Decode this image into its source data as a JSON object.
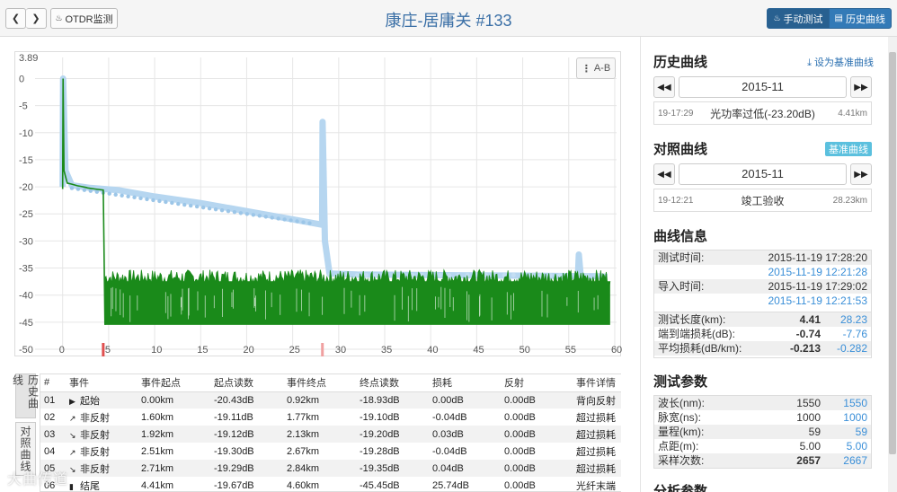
{
  "header": {
    "prev_icon": "chevron-left",
    "next_icon": "chevron-right",
    "otdr_label": "OTDR监测",
    "title": "康庄-居庸关 #133",
    "manual_test_label": "手动测试",
    "history_curve_label": "历史曲线"
  },
  "chart": {
    "ab_label": "A-B",
    "accent_current": "#1a8a1a",
    "accent_reference": "#b6d6f0",
    "marker_color": "#e05050"
  },
  "chart_data": {
    "type": "line",
    "x_ticks": [
      "0",
      "5",
      "10",
      "15",
      "20",
      "25",
      "30",
      "35",
      "40",
      "45",
      "50",
      "55",
      "60."
    ],
    "y_ticks": [
      "3.89",
      "0",
      "-5",
      "-10",
      "-15",
      "-20",
      "-25",
      "-30",
      "-35",
      "-40",
      "-45",
      "-50"
    ],
    "xlim": [
      -3,
      60.2
    ],
    "ylim": [
      -50,
      3.89
    ],
    "grid": true,
    "markers": [
      {
        "x": 4.41,
        "color": "#e05050"
      },
      {
        "x": 28.23,
        "color": "#f0a0a0"
      }
    ],
    "series": [
      {
        "color": "#1a8a1a",
        "x": [
          0,
          0.05,
          0.15,
          0.5,
          1.0,
          1.6,
          1.92,
          2.51,
          2.71,
          3.5,
          4.41,
          4.6,
          59.5
        ],
        "y": [
          -20.4,
          0,
          -17,
          -19.3,
          -19.5,
          -19.8,
          -19.9,
          -20.1,
          -20.2,
          -20.4,
          -20.6,
          -45.5,
          -45.5
        ]
      },
      {
        "color": "#b6d6f0",
        "x": [
          0,
          0.05,
          0.3,
          1.0,
          3.0,
          6.0,
          10.0,
          15.0,
          20.0,
          25.0,
          28.2,
          28.25,
          28.5,
          29.0,
          32.0,
          40.0,
          50.0,
          56.0,
          56.1,
          56.3,
          58.0,
          59.2
        ],
        "y": [
          -20.0,
          0,
          -17,
          -19.7,
          -20.2,
          -20.6,
          -21.8,
          -23.0,
          -24.5,
          -26.0,
          -27.0,
          -8.0,
          -30,
          -36.0,
          -36.2,
          -36.3,
          -36.4,
          -36.5,
          -32.5,
          -36.5,
          -36.5,
          -36.6
        ]
      }
    ]
  },
  "side_tabs": [
    "历史曲线",
    "对照曲线"
  ],
  "events": {
    "headers": [
      "#",
      "事件",
      "事件起点",
      "起点读数",
      "事件终点",
      "终点读数",
      "损耗",
      "反射",
      "事件详情"
    ],
    "rows": [
      {
        "no": "01",
        "icon": "play",
        "type": "起始",
        "start": "0.00km",
        "start_read": "-20.43dB",
        "end": "0.92km",
        "end_read": "-18.93dB",
        "loss": "0.00dB",
        "refl": "0.00dB",
        "detail": "背向反射"
      },
      {
        "no": "02",
        "icon": "rise",
        "type": "非反射",
        "start": "1.60km",
        "start_read": "-19.11dB",
        "end": "1.77km",
        "end_read": "-19.10dB",
        "loss": "-0.04dB",
        "refl": "0.00dB",
        "detail": "超过损耗"
      },
      {
        "no": "03",
        "icon": "fall",
        "type": "非反射",
        "start": "1.92km",
        "start_read": "-19.12dB",
        "end": "2.13km",
        "end_read": "-19.20dB",
        "loss": "0.03dB",
        "refl": "0.00dB",
        "detail": "超过损耗"
      },
      {
        "no": "04",
        "icon": "rise",
        "type": "非反射",
        "start": "2.51km",
        "start_read": "-19.30dB",
        "end": "2.67km",
        "end_read": "-19.28dB",
        "loss": "-0.04dB",
        "refl": "0.00dB",
        "detail": "超过损耗"
      },
      {
        "no": "05",
        "icon": "fall",
        "type": "非反射",
        "start": "2.71km",
        "start_read": "-19.29dB",
        "end": "2.84km",
        "end_read": "-19.35dB",
        "loss": "0.04dB",
        "refl": "0.00dB",
        "detail": "超过损耗"
      },
      {
        "no": "06",
        "icon": "stop",
        "type": "结尾",
        "start": "4.41km",
        "start_read": "-19.67dB",
        "end": "4.60km",
        "end_read": "-45.45dB",
        "loss": "25.74dB",
        "refl": "0.00dB",
        "detail": "光纤末端"
      }
    ]
  },
  "history": {
    "title": "历史曲线",
    "set_base_label": "设为基准曲线",
    "month": "2015-11",
    "record_time": "19-17:29",
    "record_desc": "光功率过低(-23.20dB)",
    "record_dist": "4.41km"
  },
  "compare": {
    "title": "对照曲线",
    "badge": "基准曲线",
    "month": "2015-11",
    "record_time": "19-12:21",
    "record_desc": "竣工验收",
    "record_dist": "28.23km"
  },
  "curve_info": {
    "title": "曲线信息",
    "test_time_label": "测试时间:",
    "test_time_a": "2015-11-19 17:28:20",
    "test_time_b": "2015-11-19 12:21:28",
    "import_time_label": "导入时间:",
    "import_time_a": "2015-11-19 17:29:02",
    "import_time_b": "2015-11-19 12:21:53",
    "rows": [
      {
        "label": "测试长度(km):",
        "a": "4.41",
        "b": "28.23"
      },
      {
        "label": "端到端损耗(dB):",
        "a": "-0.74",
        "b": "-7.76"
      },
      {
        "label": "平均损耗(dB/km):",
        "a": "-0.213",
        "b": "-0.282"
      }
    ]
  },
  "test_params": {
    "title": "测试参数",
    "rows": [
      {
        "label": "波长(nm):",
        "a": "1550",
        "b": "1550",
        "bold": false
      },
      {
        "label": "脉宽(ns):",
        "a": "1000",
        "b": "1000",
        "bold": false
      },
      {
        "label": "量程(km):",
        "a": "59",
        "b": "59",
        "bold": false
      },
      {
        "label": "点距(m):",
        "a": "5.00",
        "b": "5.00",
        "bold": false
      },
      {
        "label": "采样次数:",
        "a": "2657",
        "b": "2667",
        "bold": true
      }
    ]
  },
  "analysis_params": {
    "title": "分析参数"
  },
  "watermark": "大曲传道"
}
